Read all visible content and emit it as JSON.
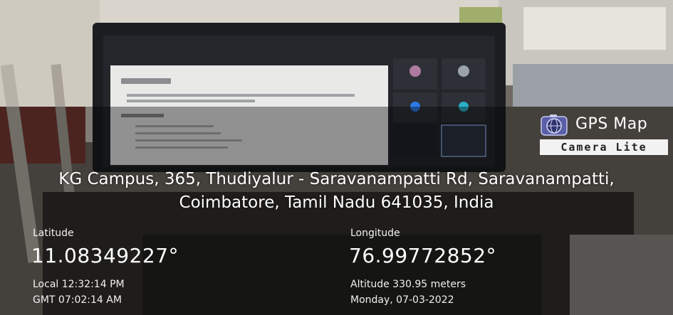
{
  "overlay": {
    "brand": {
      "icon": "globe-camera-icon",
      "name": "GPS Map",
      "edition": "Camera Lite"
    },
    "address": {
      "line1": "KG Campus, 365, Thudiyalur - Saravanampatti Rd, Saravanampatti,",
      "line2": "Coimbatore, Tamil Nadu 641035, India"
    },
    "latitude": {
      "label": "Latitude",
      "value": "11.08349227°"
    },
    "longitude": {
      "label": "Longitude",
      "value": "76.99772852°"
    },
    "time": {
      "local": "Local 12:32:14 PM",
      "gmt": "GMT 07:02:14 AM"
    },
    "altitude": "Altitude 330.95 meters",
    "date": "Monday, 07-03-2022"
  },
  "colors": {
    "overlay_tint": "#000000",
    "text": "#ffffff",
    "edition_bg": "#f2f2f2"
  }
}
